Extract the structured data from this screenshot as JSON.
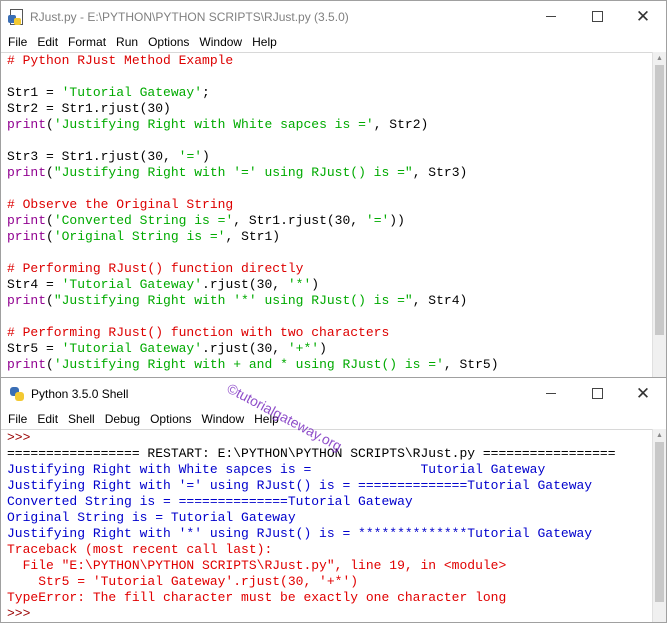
{
  "editor": {
    "title": "RJust.py - E:\\PYTHON\\PYTHON SCRIPTS\\RJust.py (3.5.0)",
    "menu": [
      "File",
      "Edit",
      "Format",
      "Run",
      "Options",
      "Window",
      "Help"
    ],
    "lines": [
      [
        {
          "t": "# Python RJust Method Example",
          "c": "c-com"
        }
      ],
      [],
      [
        {
          "t": "Str1 = ",
          "c": "c-def"
        },
        {
          "t": "'Tutorial Gateway'",
          "c": "c-str"
        },
        {
          "t": ";",
          "c": "c-def"
        }
      ],
      [
        {
          "t": "Str2 = Str1.rjust(30)",
          "c": "c-def"
        }
      ],
      [
        {
          "t": "print",
          "c": "c-kw"
        },
        {
          "t": "(",
          "c": "c-def"
        },
        {
          "t": "'Justifying Right with White sapces is ='",
          "c": "c-str"
        },
        {
          "t": ", Str2)",
          "c": "c-def"
        }
      ],
      [],
      [
        {
          "t": "Str3 = Str1.rjust(30, ",
          "c": "c-def"
        },
        {
          "t": "'='",
          "c": "c-str"
        },
        {
          "t": ")",
          "c": "c-def"
        }
      ],
      [
        {
          "t": "print",
          "c": "c-kw"
        },
        {
          "t": "(",
          "c": "c-def"
        },
        {
          "t": "\"Justifying Right with '=' using RJust() is =\"",
          "c": "c-str"
        },
        {
          "t": ", Str3)",
          "c": "c-def"
        }
      ],
      [],
      [
        {
          "t": "# Observe the Original String",
          "c": "c-com"
        }
      ],
      [
        {
          "t": "print",
          "c": "c-kw"
        },
        {
          "t": "(",
          "c": "c-def"
        },
        {
          "t": "'Converted String is ='",
          "c": "c-str"
        },
        {
          "t": ", Str1.rjust(30, ",
          "c": "c-def"
        },
        {
          "t": "'='",
          "c": "c-str"
        },
        {
          "t": "))",
          "c": "c-def"
        }
      ],
      [
        {
          "t": "print",
          "c": "c-kw"
        },
        {
          "t": "(",
          "c": "c-def"
        },
        {
          "t": "'Original String is ='",
          "c": "c-str"
        },
        {
          "t": ", Str1)",
          "c": "c-def"
        }
      ],
      [],
      [
        {
          "t": "# Performing RJust() function directly",
          "c": "c-com"
        }
      ],
      [
        {
          "t": "Str4 = ",
          "c": "c-def"
        },
        {
          "t": "'Tutorial Gateway'",
          "c": "c-str"
        },
        {
          "t": ".rjust(30, ",
          "c": "c-def"
        },
        {
          "t": "'*'",
          "c": "c-str"
        },
        {
          "t": ")",
          "c": "c-def"
        }
      ],
      [
        {
          "t": "print",
          "c": "c-kw"
        },
        {
          "t": "(",
          "c": "c-def"
        },
        {
          "t": "\"Justifying Right with '*' using RJust() is =\"",
          "c": "c-str"
        },
        {
          "t": ", Str4)",
          "c": "c-def"
        }
      ],
      [],
      [
        {
          "t": "# Performing RJust() function with two characters",
          "c": "c-com"
        }
      ],
      [
        {
          "t": "Str5 = ",
          "c": "c-def"
        },
        {
          "t": "'Tutorial Gateway'",
          "c": "c-str"
        },
        {
          "t": ".rjust(30, ",
          "c": "c-def"
        },
        {
          "t": "'+*'",
          "c": "c-str"
        },
        {
          "t": ")",
          "c": "c-def"
        }
      ],
      [
        {
          "t": "print",
          "c": "c-kw"
        },
        {
          "t": "(",
          "c": "c-def"
        },
        {
          "t": "'Justifying Right with + and * using RJust() is ='",
          "c": "c-str"
        },
        {
          "t": ", Str5)",
          "c": "c-def"
        }
      ]
    ]
  },
  "shell": {
    "title": "Python 3.5.0 Shell",
    "menu": [
      "File",
      "Edit",
      "Shell",
      "Debug",
      "Options",
      "Window",
      "Help"
    ],
    "lines": [
      [
        {
          "t": ">>> ",
          "c": "c-prompt"
        }
      ],
      [
        {
          "t": "================= RESTART: E:\\PYTHON\\PYTHON SCRIPTS\\RJust.py =================",
          "c": "c-def"
        }
      ],
      [
        {
          "t": "Justifying Right with White sapces is =              Tutorial Gateway",
          "c": "c-out"
        }
      ],
      [
        {
          "t": "Justifying Right with '=' using RJust() is = ==============Tutorial Gateway",
          "c": "c-out"
        }
      ],
      [
        {
          "t": "Converted String is = ==============Tutorial Gateway",
          "c": "c-out"
        }
      ],
      [
        {
          "t": "Original String is = Tutorial Gateway",
          "c": "c-out"
        }
      ],
      [
        {
          "t": "Justifying Right with '*' using RJust() is = **************Tutorial Gateway",
          "c": "c-out"
        }
      ],
      [
        {
          "t": "Traceback (most recent call last):",
          "c": "c-err"
        }
      ],
      [
        {
          "t": "  File \"E:\\PYTHON\\PYTHON SCRIPTS\\RJust.py\", line 19, in <module>",
          "c": "c-err"
        }
      ],
      [
        {
          "t": "    Str5 = 'Tutorial Gateway'.rjust(30, '+*')",
          "c": "c-err"
        }
      ],
      [
        {
          "t": "TypeError: The fill character must be exactly one character long",
          "c": "c-err"
        }
      ],
      [
        {
          "t": ">>> ",
          "c": "c-prompt"
        }
      ]
    ]
  },
  "watermark": "©tutorialgateway.org",
  "window_controls": {
    "minimize": "—",
    "maximize": "☐",
    "close": "✕"
  }
}
